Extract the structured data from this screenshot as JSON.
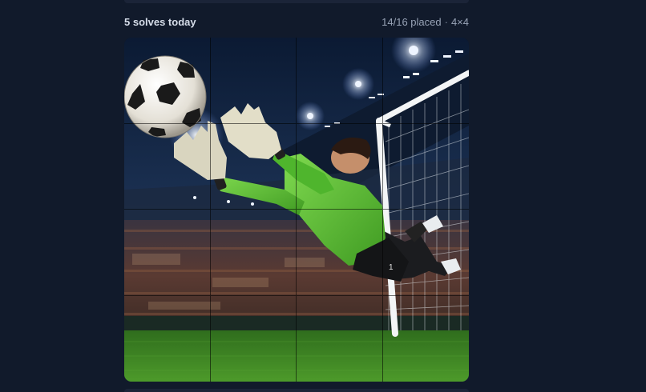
{
  "header": {
    "solves_text": "5 solves today",
    "placed_text": "14/16 placed",
    "separator": "·",
    "grid_size": "4×4"
  },
  "puzzle": {
    "rows": 4,
    "cols": 4,
    "placed": 14,
    "total": 16,
    "subject": "goalkeeper-diving-save",
    "tiles": [
      {
        "id": 1
      },
      {
        "id": 2
      },
      {
        "id": 3
      },
      {
        "id": 4
      },
      {
        "id": 5
      },
      {
        "id": 6
      },
      {
        "id": 7
      },
      {
        "id": 8
      },
      {
        "id": 9
      },
      {
        "id": 10
      },
      {
        "id": 11
      },
      {
        "id": 12
      },
      {
        "id": 13
      },
      {
        "id": 14
      },
      {
        "id": 15
      },
      {
        "id": 16
      }
    ],
    "jersey_number": "1"
  },
  "colors": {
    "background": "#111a2b",
    "jersey": "#5fc43a",
    "pitch": "#3f8a25",
    "sky": "#0c1a33"
  }
}
